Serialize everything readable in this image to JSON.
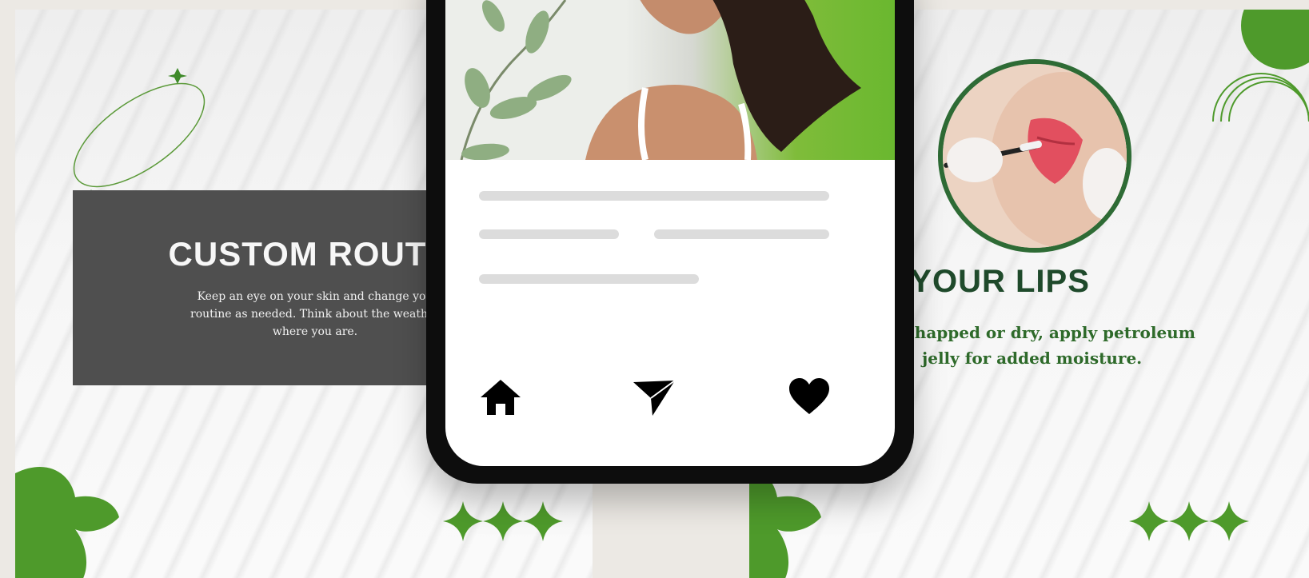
{
  "left_card": {
    "title": "CUSTOM ROUTIN",
    "body": "Keep an eye on your skin and change you\nroutine as needed. Think about the weather\nwhere you are."
  },
  "right_card": {
    "title": "REAT YOUR LIPS",
    "body_line1": "feel chapped or dry, apply petroleum",
    "body_line2": "jelly for added moisture."
  },
  "phone": {
    "nav": [
      "home-icon",
      "send-icon",
      "heart-icon"
    ]
  },
  "colors": {
    "accent_green": "#4e9a2b",
    "dark_green": "#1f4a2b",
    "panel_gray": "#4f4f4f",
    "skeleton_gray": "#dcdcdc"
  }
}
